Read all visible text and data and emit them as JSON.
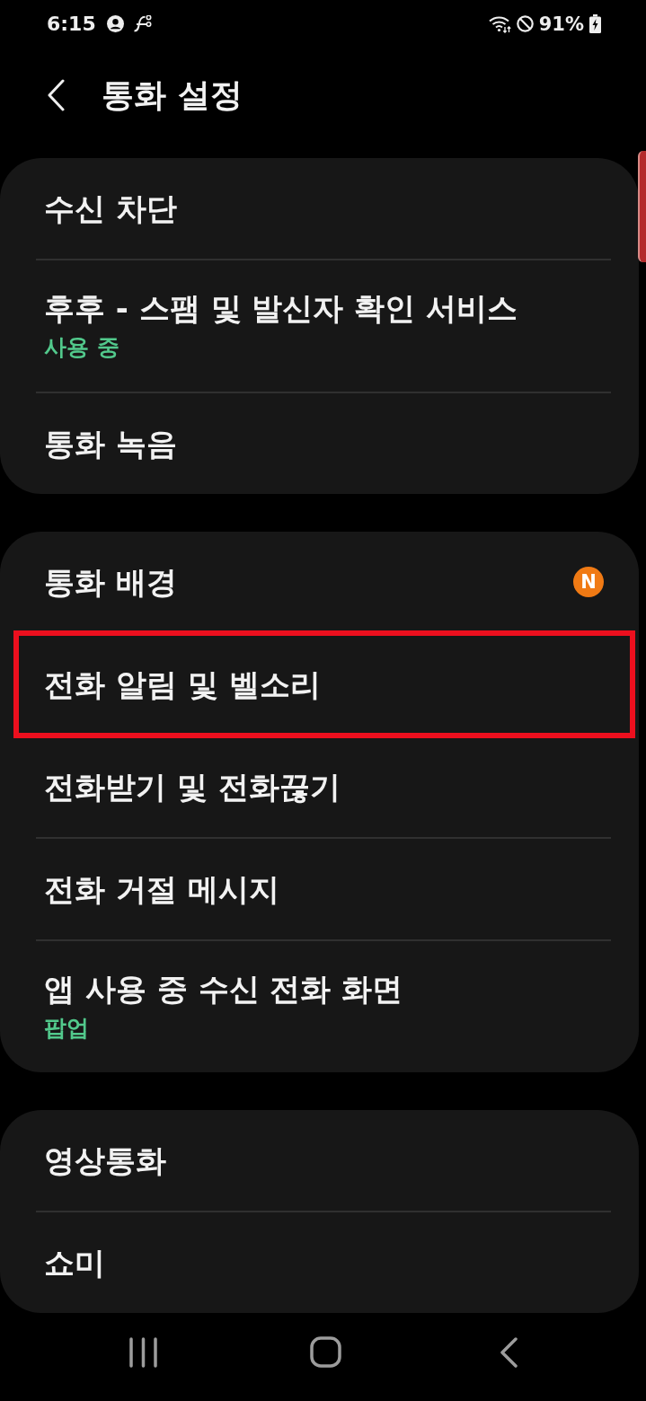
{
  "status_bar": {
    "time": "6:15",
    "battery": "91%"
  },
  "header": {
    "title": "통화 설정"
  },
  "groups": [
    {
      "items": [
        {
          "title": "수신 차단",
          "highlighted": false
        },
        {
          "title": "후후 - 스팸 및 발신자 확인 서비스",
          "subtitle": "사용 중",
          "highlighted": false
        },
        {
          "title": "통화 녹음",
          "highlighted": false
        }
      ]
    },
    {
      "items": [
        {
          "title": "통화 배경",
          "badge": "N",
          "highlighted": false
        },
        {
          "title": "전화 알림 및 벨소리",
          "highlighted": true
        },
        {
          "title": "전화받기 및 전화끊기",
          "highlighted": false
        },
        {
          "title": "전화 거절 메시지",
          "highlighted": false
        },
        {
          "title": "앱 사용 중 수신 전화 화면",
          "subtitle": "팝업",
          "highlighted": false
        }
      ]
    },
    {
      "items": [
        {
          "title": "영상통화",
          "highlighted": false
        },
        {
          "title": "쇼미",
          "highlighted": false
        }
      ]
    }
  ]
}
